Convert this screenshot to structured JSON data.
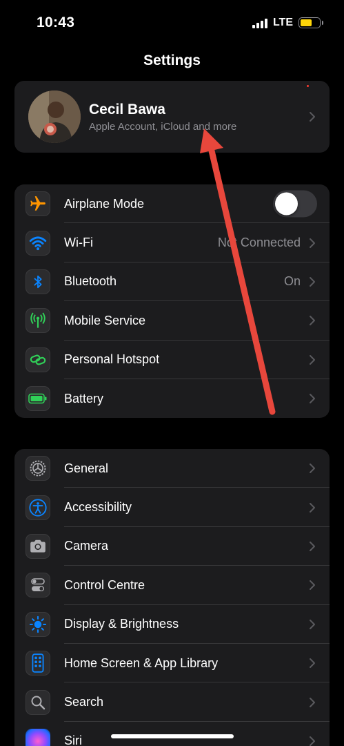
{
  "status": {
    "time": "10:43",
    "network": "LTE"
  },
  "title": "Settings",
  "profile": {
    "name": "Cecil Bawa",
    "subtitle": "Apple Account, iCloud and more"
  },
  "connectivity": [
    {
      "label": "Airplane Mode",
      "icon": "airplane-icon",
      "color": "#ff9500",
      "toggle": false
    },
    {
      "label": "Wi-Fi",
      "value": "Not Connected",
      "icon": "wifi-icon",
      "color": "#0a84ff"
    },
    {
      "label": "Bluetooth",
      "value": "On",
      "icon": "bluetooth-icon",
      "color": "#0a84ff"
    },
    {
      "label": "Mobile Service",
      "icon": "antenna-icon",
      "color": "#30d158"
    },
    {
      "label": "Personal Hotspot",
      "icon": "hotspot-icon",
      "color": "#30d158"
    },
    {
      "label": "Battery",
      "icon": "battery-icon",
      "color": "#30d158"
    }
  ],
  "general": [
    {
      "label": "General",
      "icon": "gear-icon",
      "color": "#8e8e93"
    },
    {
      "label": "Accessibility",
      "icon": "accessibility-icon",
      "color": "#0a84ff"
    },
    {
      "label": "Camera",
      "icon": "camera-icon",
      "color": "#8e8e93"
    },
    {
      "label": "Control Centre",
      "icon": "control-centre-icon",
      "color": "#8e8e93"
    },
    {
      "label": "Display & Brightness",
      "icon": "sun-icon",
      "color": "#0a84ff"
    },
    {
      "label": "Home Screen & App Library",
      "icon": "home-screen-icon",
      "color": "#0a84ff"
    },
    {
      "label": "Search",
      "icon": "search-icon",
      "color": "#8e8e93"
    },
    {
      "label": "Siri",
      "icon": "siri-icon",
      "color": "#bf5af2"
    }
  ],
  "annotation": {
    "color": "#e8473c"
  }
}
